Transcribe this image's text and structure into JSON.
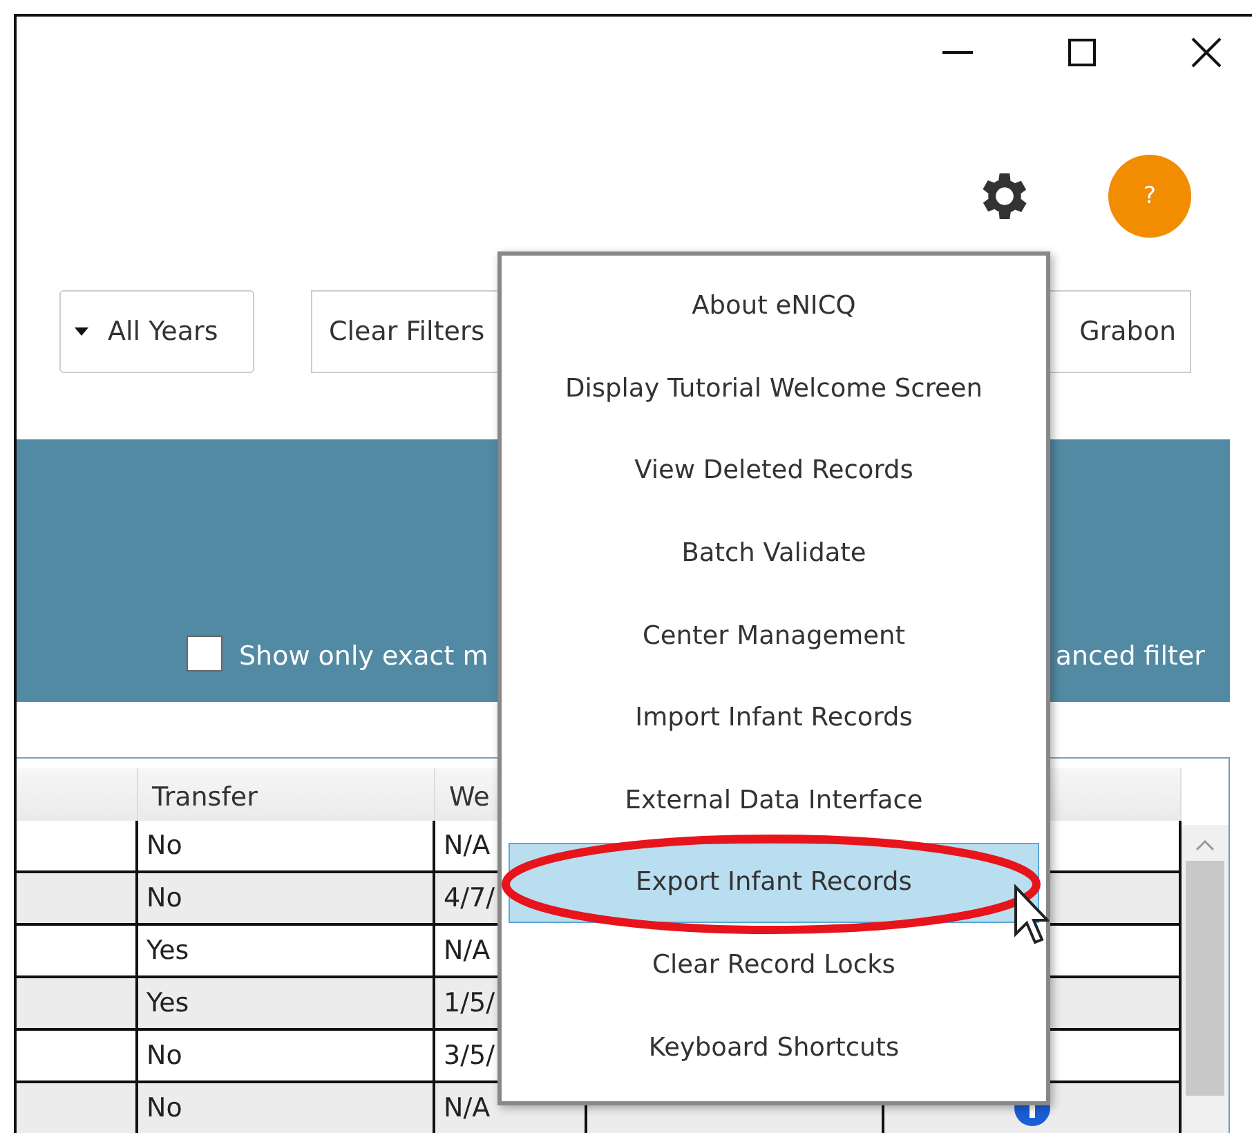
{
  "help_button": "?",
  "filters": {
    "year_dropdown": "All Years",
    "clear_button": "Clear Filters",
    "user_field": "Grabon"
  },
  "search_panel": {
    "exact_match": {
      "label": "Show only exact m",
      "checked": false
    },
    "advanced_filter": "anced filter"
  },
  "table": {
    "headers": {
      "column_2": "Transfer",
      "column_3": "We"
    },
    "rows": [
      {
        "transfer": "No",
        "column_3": "N/A"
      },
      {
        "transfer": "No",
        "column_3": "4/7/"
      },
      {
        "transfer": "Yes",
        "column_3": "N/A"
      },
      {
        "transfer": "Yes",
        "column_3": "1/5/"
      },
      {
        "transfer": "No",
        "column_3": "3/5/"
      },
      {
        "transfer": "No",
        "column_3": "N/A",
        "info": true
      }
    ]
  },
  "menu": {
    "items": [
      {
        "label": "About eNICQ",
        "selected": false
      },
      {
        "label": "Display Tutorial Welcome Screen",
        "selected": false
      },
      {
        "label": "View Deleted Records",
        "selected": false
      },
      {
        "label": "Batch Validate",
        "selected": false
      },
      {
        "label": "Center Management",
        "selected": false
      },
      {
        "label": "Import Infant Records",
        "selected": false
      },
      {
        "label": "External Data Interface",
        "selected": false
      },
      {
        "label": "Export Infant Records",
        "selected": true
      },
      {
        "label": "Clear Record Locks",
        "selected": false
      },
      {
        "label": "Keyboard Shortcuts",
        "selected": false
      }
    ]
  }
}
